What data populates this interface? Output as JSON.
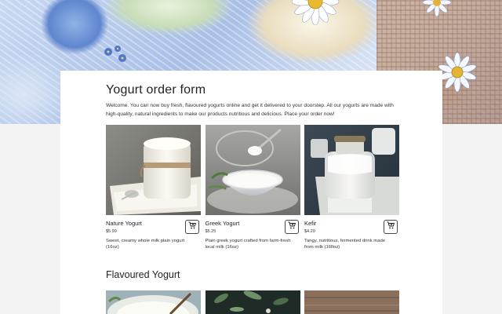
{
  "page": {
    "title": "Yogurt order form",
    "intro": "Welcome. You can now buy fresh, flavoured yogurts online and get it delivered to your doorstep. All our yogurts are made with high-quality, natural ingredients to make our products nutritious and delicious. Place your order now!"
  },
  "products": [
    {
      "name": "Nature Yogurt",
      "price": "$5.99",
      "description": "Sweet, creamy whole milk plain yogurt (16oz)",
      "image": "nature-yogurt-jar-photo"
    },
    {
      "name": "Greek Yogurt",
      "price": "$5.25",
      "description": "Plain greek yogurt crafted from farm-fresh local milk (16oz)",
      "image": "greek-yogurt-bowl-photo"
    },
    {
      "name": "Kefir",
      "price": "$4.20",
      "description": "Tangy, nutritious, fermented drink made from milk (16floz)",
      "image": "kefir-bottle-photo"
    }
  ],
  "flavoured": {
    "title": "Flavoured Yogurt",
    "images": [
      "yogurt-bowl-photo",
      "dark-leaves-photo",
      "wooden-table-photo"
    ]
  },
  "icons": {
    "cart": "add-to-cart-icon",
    "hero_flower": "daisy-icon"
  },
  "colors": {
    "card": "#ffffff",
    "page_background": "#f3f3f3",
    "text": "#222222"
  }
}
